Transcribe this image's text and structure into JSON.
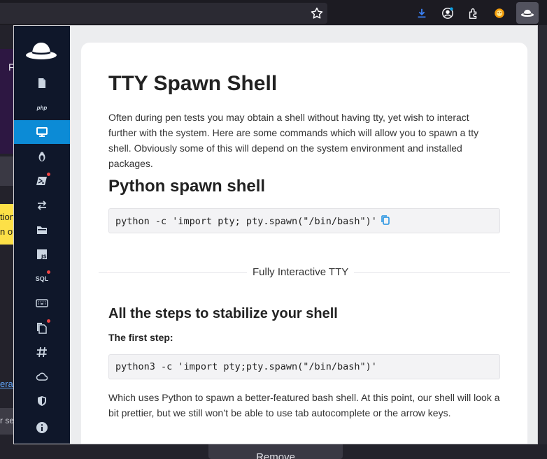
{
  "browser": {
    "icons": [
      "star-icon",
      "download-icon",
      "account-icon",
      "extensions-icon",
      "extension-fox-icon",
      "extension-hat-icon"
    ]
  },
  "background": {
    "header_letter": "F",
    "yellow_line1": "tion",
    "yellow_line2": "n of",
    "link_text": "era",
    "input_text": "r se",
    "remove_button": "Remove"
  },
  "sidebar": {
    "items": [
      {
        "name": "file-icon",
        "active": false,
        "badge": false
      },
      {
        "name": "php-icon",
        "label": "php",
        "active": false,
        "badge": false
      },
      {
        "name": "monitor-icon",
        "active": true,
        "badge": false
      },
      {
        "name": "linux-icon",
        "active": false,
        "badge": false
      },
      {
        "name": "powershell-icon",
        "active": false,
        "badge": true
      },
      {
        "name": "arrows-icon",
        "active": false,
        "badge": false
      },
      {
        "name": "folder-icon",
        "active": false,
        "badge": false
      },
      {
        "name": "js-icon",
        "active": false,
        "badge": false
      },
      {
        "name": "sql-icon",
        "label": "SQL",
        "active": false,
        "badge": true
      },
      {
        "name": "keyboard-icon",
        "active": false,
        "badge": false
      },
      {
        "name": "files-icon",
        "active": false,
        "badge": true
      },
      {
        "name": "hash-icon",
        "active": false,
        "badge": false
      },
      {
        "name": "cloud-icon",
        "active": false,
        "badge": false
      },
      {
        "name": "shield-icon",
        "active": false,
        "badge": false
      },
      {
        "name": "info-icon",
        "active": false,
        "badge": false
      }
    ]
  },
  "page": {
    "title": "TTY Spawn Shell",
    "intro": "Often during pen tests you may obtain a shell without having tty, yet wish to interact further with the system. Here are some commands which will allow you to spawn a tty shell. Obviously some of this will depend on the system environment and installed packages.",
    "python_heading": "Python spawn shell",
    "python_code": "python -c 'import pty; pty.spawn(\"/bin/bash\")'",
    "divider_label": "Fully Interactive TTY",
    "stabilize_heading": "All the steps to stabilize your shell",
    "first_step_label": "The first step:",
    "first_step_code": "python3 -c 'import pty;pty.spawn(\"/bin/bash\")'",
    "first_step_desc": "Which uses Python to spawn a better-featured bash shell. At this point, our shell will look a bit prettier, but we still won’t be able to use tab autocomplete or the arrow keys."
  },
  "colors": {
    "sidebar_bg": "#0f172a",
    "active_item": "#0c8bd6",
    "badge": "#ef4444",
    "copy_icon": "#1d8fe1"
  }
}
